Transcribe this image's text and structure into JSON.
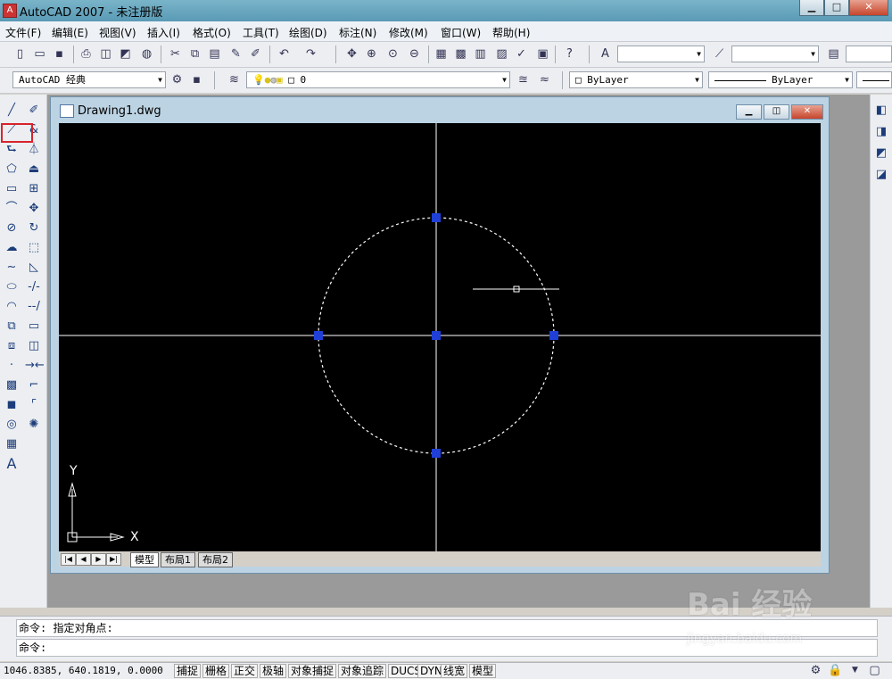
{
  "window": {
    "title": "AutoCAD 2007 - 未注册版",
    "app_icon": "autocad-icon",
    "controls": [
      "minimize",
      "maximize",
      "close"
    ]
  },
  "menu": [
    "文件(F)",
    "编辑(E)",
    "视图(V)",
    "插入(I)",
    "格式(O)",
    "工具(T)",
    "绘图(D)",
    "标注(N)",
    "修改(M)",
    "窗口(W)",
    "帮助(H)"
  ],
  "toolbar2": {
    "workspace": "AutoCAD 经典",
    "layer": "0",
    "color": "ByLayer",
    "linetype": "ByLayer"
  },
  "drawing": {
    "filename": "Drawing1.dwg",
    "axis_y_label": "Y",
    "axis_x_label": "X",
    "tabs": [
      "模型",
      "布局1",
      "布局2"
    ],
    "active_tab": "模型"
  },
  "command": {
    "line1": "命令: 指定对角点:",
    "line2": "命令:"
  },
  "status": {
    "coords": "1046.8385, 640.1819, 0.0000",
    "buttons": [
      "捕捉",
      "栅格",
      "正交",
      "极轴",
      "对象捕捉",
      "对象追踪",
      "DUCS",
      "DYN",
      "线宽",
      "模型"
    ]
  },
  "watermark": {
    "main": "Bai 经验",
    "sub": "jingyan.baidu.com"
  },
  "colors": {
    "grip": "#1f3fd6",
    "canvas": "#000000",
    "highlight": "#d9232d"
  }
}
